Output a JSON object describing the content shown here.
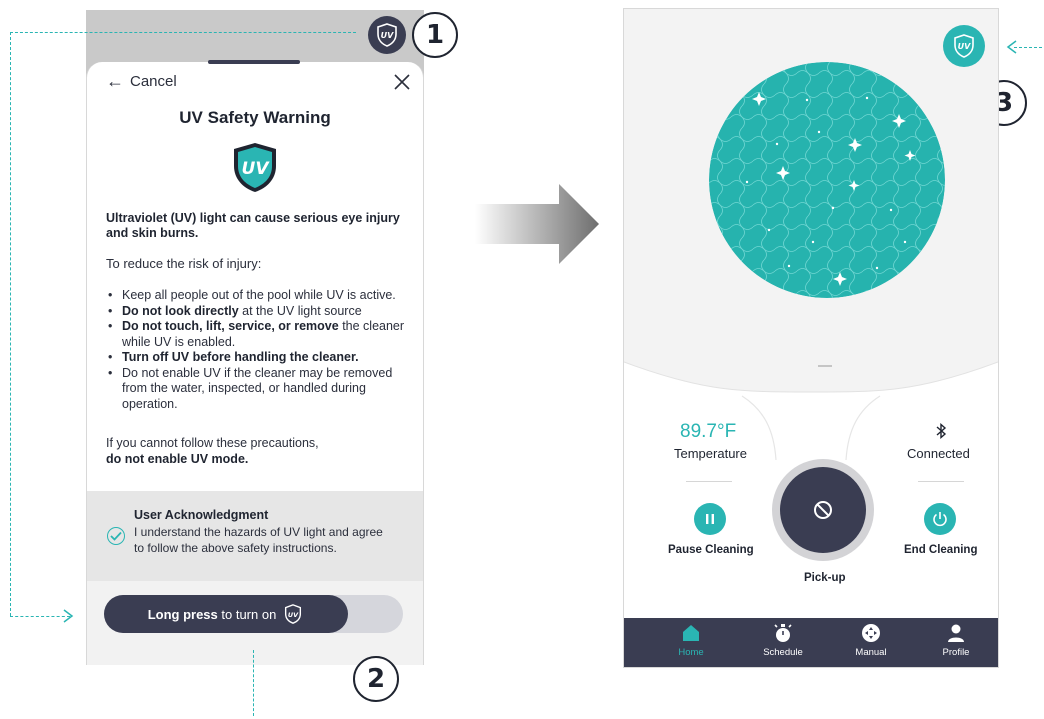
{
  "callouts": {
    "one": "1",
    "two": "2",
    "three": "3"
  },
  "colors": {
    "accent": "#2ab5b3",
    "dark": "#3a3d52",
    "overlay": "#c9c9c9"
  },
  "modal": {
    "cancel_label": "Cancel",
    "title": "UV Safety Warning",
    "shield_letters": "UV",
    "warning": "Ultraviolet (UV) light can cause serious eye injury and skin burns.",
    "reduce_risk": "To reduce the risk of injury:",
    "bullets": [
      {
        "bold": "",
        "text": "Keep all people out of the pool while UV is active."
      },
      {
        "bold": "Do not look directly",
        "text": " at the UV light source"
      },
      {
        "bold": "Do not touch, lift, service, or remove",
        "text": " the cleaner while UV is enabled."
      },
      {
        "bold": "Turn off UV before handling the cleaner.",
        "text": ""
      },
      {
        "bold": "",
        "text": "Do not enable UV if the cleaner may be removed from the water, inspected, or handled during operation."
      }
    ],
    "cannot_follow": "If you cannot follow these precautions,",
    "do_not_enable": "do not enable UV mode.",
    "ack_title": "User Acknowledgment",
    "ack_body": "I understand the hazards of UV light and agree to follow the above safety instructions.",
    "ack_checked": true,
    "slider_bold": "Long press",
    "slider_text": " to turn on",
    "icons": [
      "uv-shield-icon",
      "close-icon",
      "back-arrow-icon",
      "check-icon"
    ]
  },
  "home": {
    "temperature_value": "89.7°F",
    "temperature_label": "Temperature",
    "connection_label": "Connected",
    "pause_label": "Pause Cleaning",
    "end_label": "End Cleaning",
    "pickup_label": "Pick-up",
    "uv_active": true,
    "icons": [
      "uv-shield-icon",
      "bluetooth-icon",
      "pause-icon",
      "power-icon",
      "block-icon"
    ]
  },
  "nav": [
    {
      "label": "Home",
      "icon": "home-icon",
      "active": true
    },
    {
      "label": "Schedule",
      "icon": "stopwatch-icon",
      "active": false
    },
    {
      "label": "Manual",
      "icon": "gamepad-icon",
      "active": false
    },
    {
      "label": "Profile",
      "icon": "person-icon",
      "active": false
    }
  ]
}
